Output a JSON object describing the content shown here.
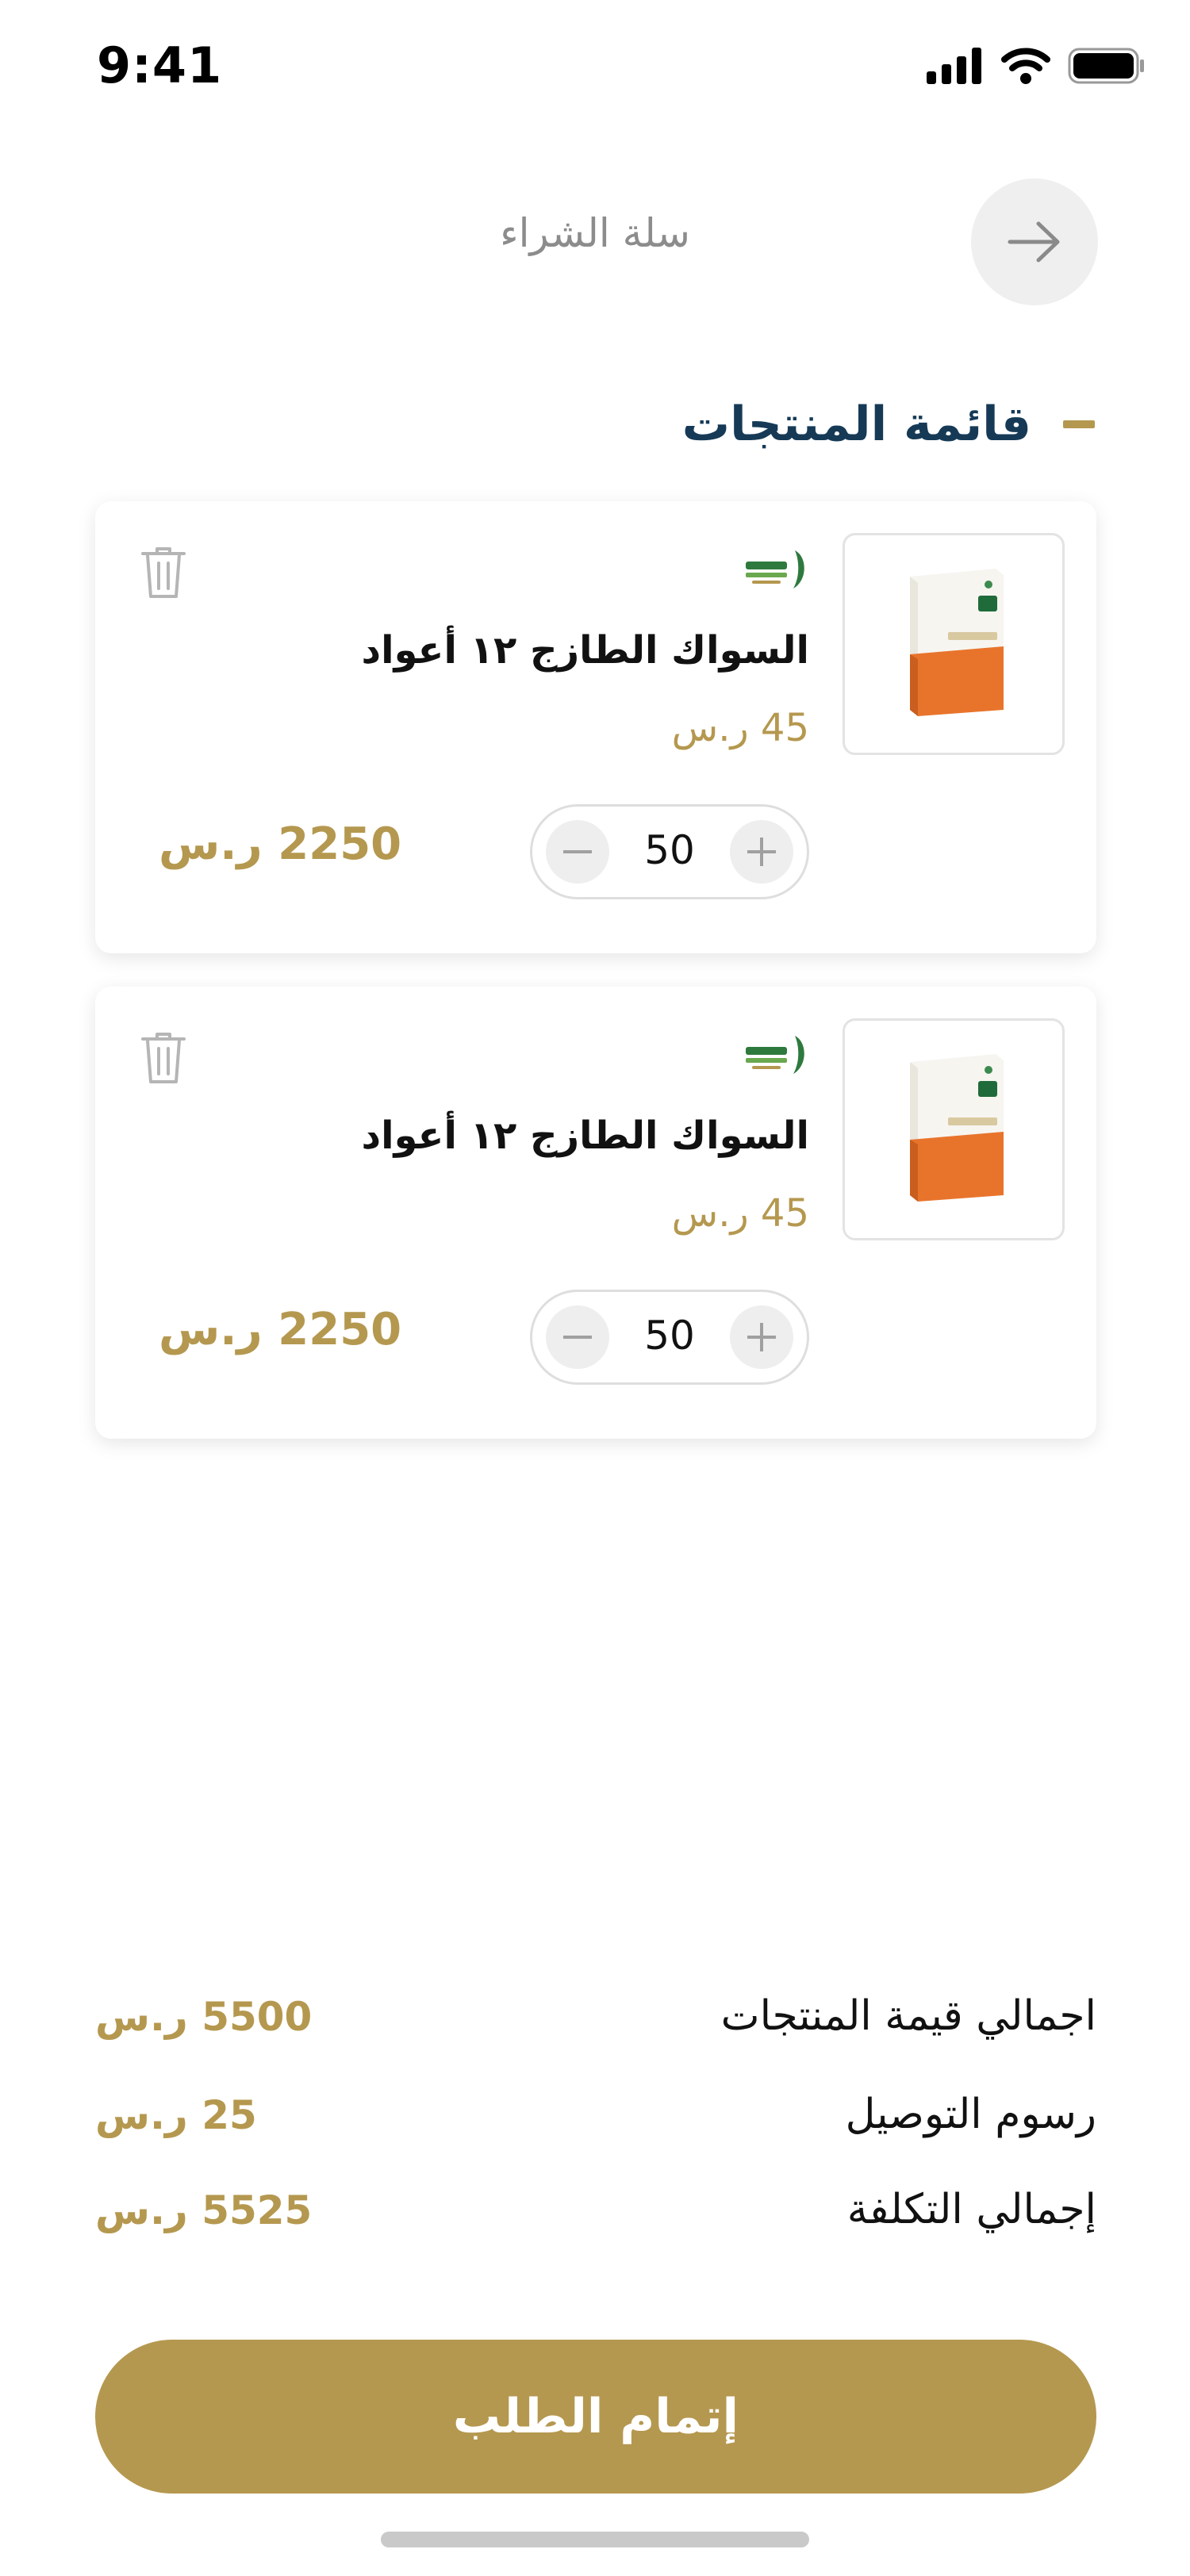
{
  "status_bar": {
    "time": "9:41"
  },
  "header": {
    "title": "سلة الشراء"
  },
  "section": {
    "title": "قائمة المنتجات"
  },
  "cart_items": [
    {
      "name": "السواك الطازج ١٢ أعواد",
      "unit_price": "45 ر.س",
      "quantity": "50",
      "line_total": "2250 ر.س"
    },
    {
      "name": "السواك الطازج ١٢ أعواد",
      "unit_price": "45 ر.س",
      "quantity": "50",
      "line_total": "2250 ر.س"
    }
  ],
  "summary": {
    "subtotal_label": "اجمالي قيمة المنتجات",
    "subtotal_value": "5500 ر.س",
    "delivery_label": "رسوم التوصيل",
    "delivery_value": "25 ر.س",
    "total_label": "إجمالي التكلفة",
    "total_value": "5525 ر.س"
  },
  "checkout": {
    "label": "إتمام الطلب"
  },
  "colors": {
    "accent": "#b5984f",
    "title_navy": "#163a56"
  },
  "icons": [
    "signal-icon",
    "wifi-icon",
    "battery-icon",
    "arrow-right-icon",
    "trash-icon",
    "minus-icon",
    "plus-icon",
    "brand-logo"
  ]
}
